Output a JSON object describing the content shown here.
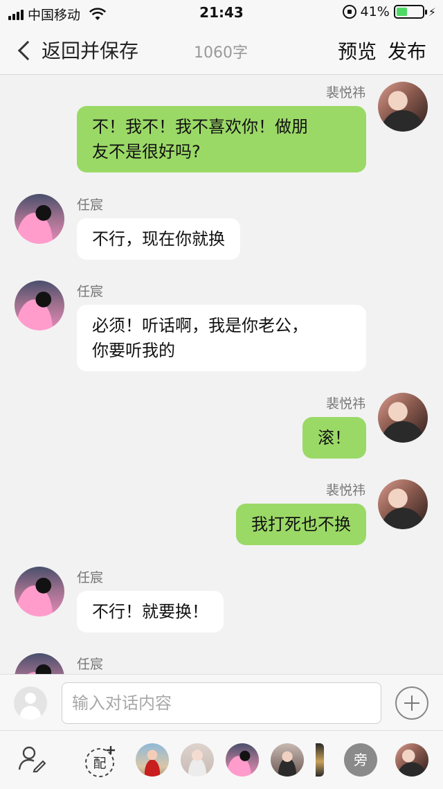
{
  "status_bar": {
    "carrier": "中国移动",
    "time": "21:43",
    "battery_percent": "41%",
    "battery_level": 0.41,
    "icons": [
      "signal-icon",
      "wifi-icon",
      "rotation-lock-icon",
      "battery-icon",
      "charging-icon"
    ]
  },
  "nav": {
    "back_label": "返回并保存",
    "word_count": "1060字",
    "preview_label": "预览",
    "publish_label": "发布"
  },
  "messages": [
    {
      "side": "right",
      "sender": "裴悦祎",
      "lines": [
        "不！我不！我不喜欢你！做朋",
        "友不是很好吗?"
      ]
    },
    {
      "side": "left",
      "sender": "任宸",
      "lines": [
        "不行，现在你就换"
      ]
    },
    {
      "side": "left",
      "sender": "任宸",
      "lines": [
        "必须！听话啊，我是你老公，",
        "你要听我的"
      ]
    },
    {
      "side": "right",
      "sender": "裴悦祎",
      "lines": [
        "滚！"
      ]
    },
    {
      "side": "right",
      "sender": "裴悦祎",
      "lines": [
        "我打死也不换"
      ]
    },
    {
      "side": "left",
      "sender": "任宸",
      "lines": [
        "不行！就要换！"
      ]
    },
    {
      "side": "left",
      "sender": "任宸",
      "lines": []
    }
  ],
  "input": {
    "placeholder": "输入对话内容",
    "value": ""
  },
  "role_bar": {
    "pair_label": "配",
    "narrator_label": "旁"
  },
  "colors": {
    "outgoing_bubble": "#9bd967",
    "incoming_bubble": "#ffffff",
    "chat_background": "#f2f2f2"
  }
}
